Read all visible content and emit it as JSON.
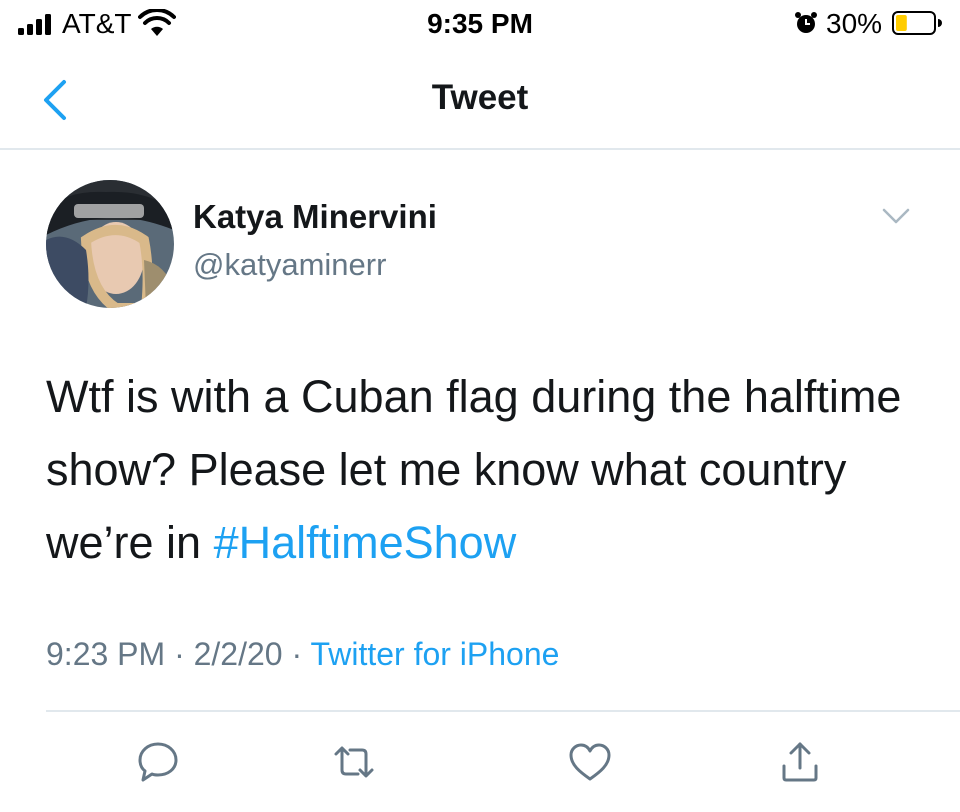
{
  "status_bar": {
    "carrier": "AT&T",
    "time": "9:35 PM",
    "battery_percent": "30%",
    "battery_level": 0.3,
    "battery_color": "#ffcc00",
    "icons": [
      "signal-icon",
      "wifi-icon",
      "alarm-icon",
      "battery-icon"
    ]
  },
  "nav": {
    "title": "Tweet",
    "back_icon": "chevron-left-icon",
    "accent": "#1da1f2"
  },
  "tweet": {
    "author_name": "Katya Minervini",
    "author_handle": "@katyaminerr",
    "text": "Wtf is with a Cuban flag during the halftime show? Please let me know what country we’re in ",
    "hashtag": "#HalftimeShow",
    "time": "9:23 PM",
    "separator": "·",
    "date": "2/2/20",
    "source": "Twitter for iPhone"
  },
  "actions": [
    {
      "name": "reply",
      "icon": "reply-icon"
    },
    {
      "name": "retweet",
      "icon": "retweet-icon"
    },
    {
      "name": "like",
      "icon": "heart-icon"
    },
    {
      "name": "share",
      "icon": "share-icon"
    }
  ],
  "colors": {
    "text": "#14171a",
    "secondary": "#657786",
    "link": "#1da1f2",
    "divider": "#e1e8ed"
  }
}
